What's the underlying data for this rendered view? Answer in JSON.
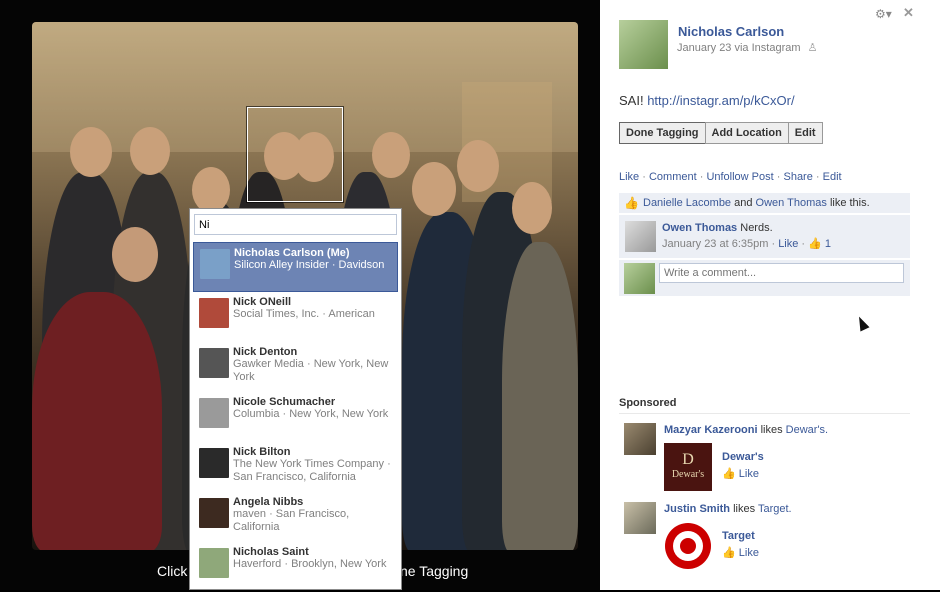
{
  "photo": {
    "bottom_caption_left": "Click",
    "bottom_caption_right": "ne Tagging"
  },
  "tagger": {
    "input_value": "Ni",
    "results": [
      {
        "name": "Nicholas Carlson (Me)",
        "sub": "Silicon Alley Insider · Davidson",
        "selected": true,
        "avatar_color": "#7aa0c8"
      },
      {
        "name": "Nick ONeill",
        "sub": "Social Times, Inc. · American",
        "selected": false,
        "avatar_color": "#b04a3a"
      },
      {
        "name": "Nick Denton",
        "sub": "Gawker Media · New York, New York",
        "selected": false,
        "avatar_color": "#555555"
      },
      {
        "name": "Nicole Schumacher",
        "sub": "Columbia · New York, New York",
        "selected": false,
        "avatar_color": "#9a9a9a"
      },
      {
        "name": "Nick Bilton",
        "sub": "The New York Times Company · San Francisco, California",
        "selected": false,
        "avatar_color": "#2a2a2a"
      },
      {
        "name": "Angela Nibbs",
        "sub": "maven · San Francisco, California",
        "selected": false,
        "avatar_color": "#3d2a20"
      },
      {
        "name": "Nicholas Saint",
        "sub": "Haverford · Brooklyn, New York",
        "selected": false,
        "avatar_color": "#8fa87a"
      }
    ]
  },
  "post": {
    "owner_name": "Nicholas Carlson",
    "meta": "January 23 via Instagram",
    "privacy_icon": "friends-icon",
    "caption_text": "SAI!",
    "caption_link": "http://instagr.am/p/kCxOr/",
    "buttons": [
      "Done Tagging",
      "Add Location",
      "Edit"
    ],
    "links": [
      "Like",
      "Comment",
      "Unfollow Post",
      "Share",
      "Edit"
    ],
    "likes": {
      "person1": "Danielle Lacombe",
      "and": "and",
      "person2": "Owen Thomas",
      "suffix": "like this."
    },
    "comment": {
      "author": "Owen Thomas",
      "text": "Nerds.",
      "time": "January 23 at 6:35pm",
      "like": "Like",
      "like_count": "1"
    },
    "write_placeholder": "Write a comment..."
  },
  "sponsored": {
    "heading": "Sponsored",
    "ads": [
      {
        "person": "Mazyar Kazerooni",
        "verb": "likes",
        "page": "Dewar's.",
        "brand": "Dewar's",
        "like": "Like",
        "logo_text": "Dewar's",
        "logo_color": "#4a1410"
      },
      {
        "person": "Justin Smith",
        "verb": "likes",
        "page": "Target.",
        "brand": "Target",
        "like": "Like",
        "logo_color": "#cc0000"
      }
    ]
  },
  "icons": {
    "gear": "gear-icon",
    "close": "close-icon",
    "thumb": "thumbs-up-icon"
  }
}
